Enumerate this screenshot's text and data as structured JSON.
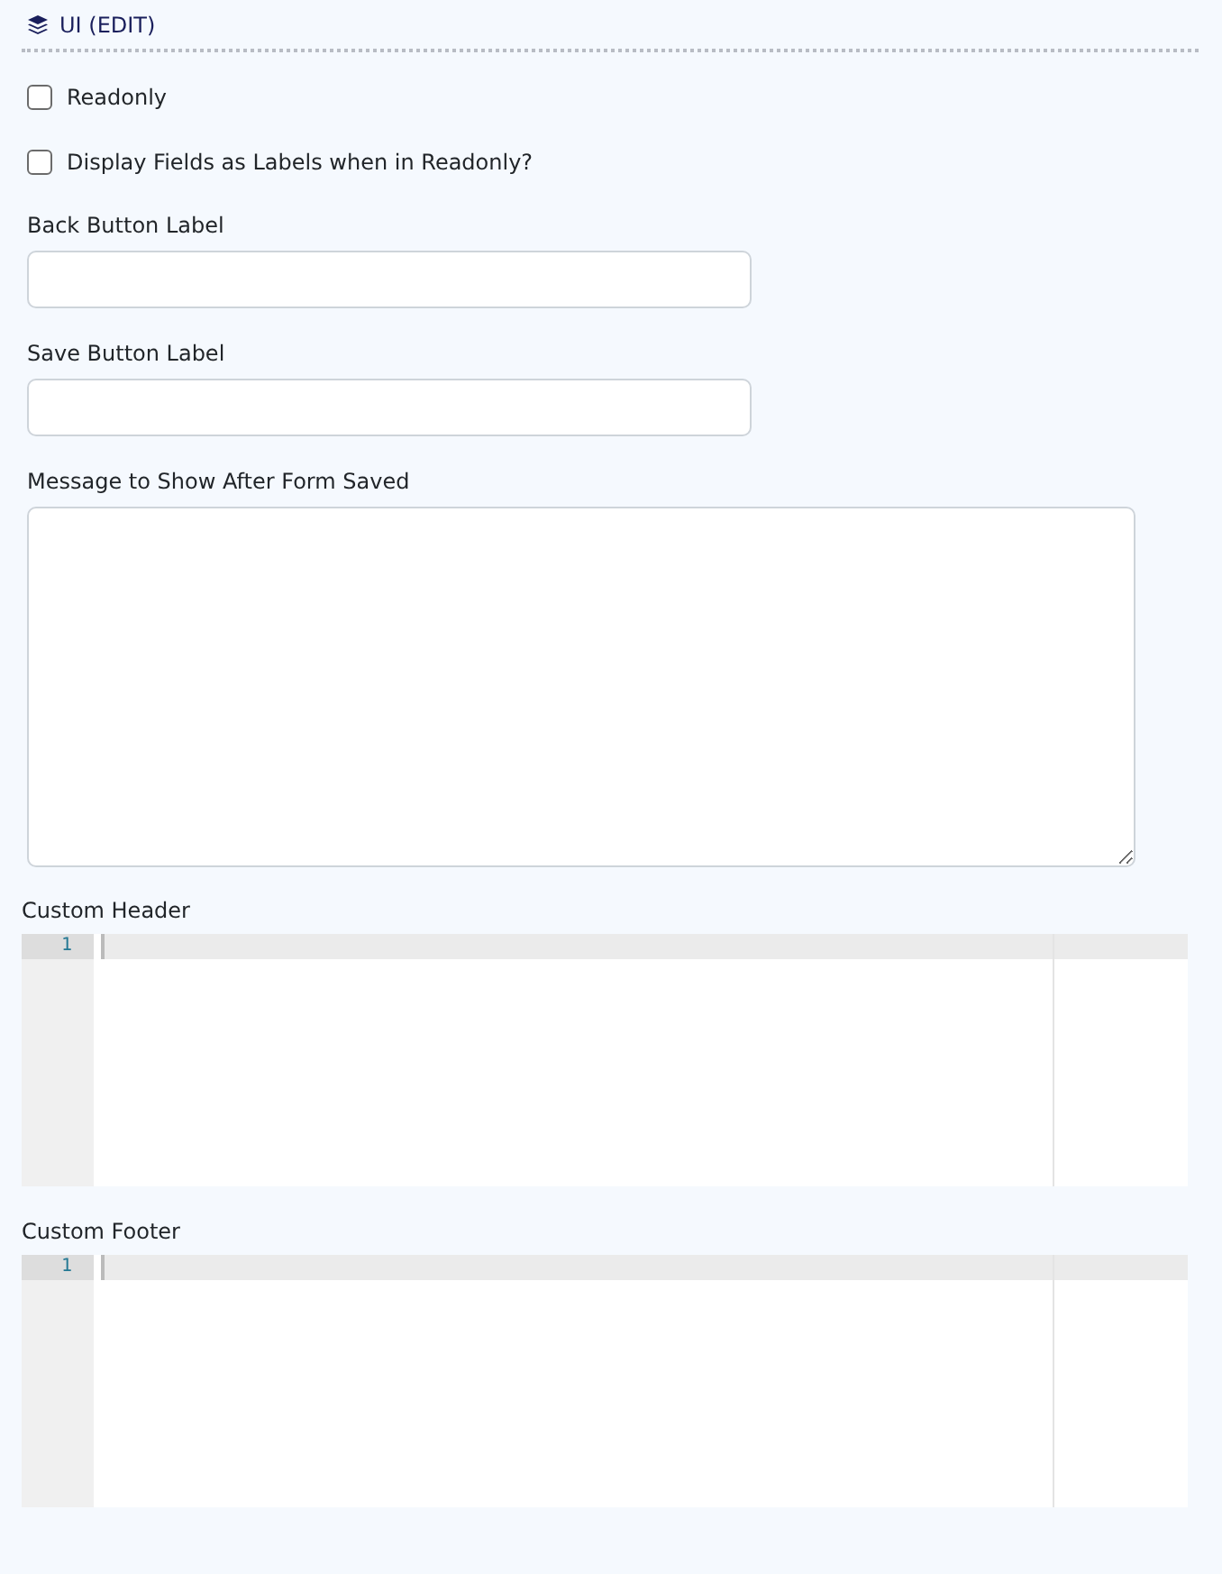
{
  "section": {
    "title": "UI (EDIT)"
  },
  "checkboxes": [
    {
      "label": "Readonly",
      "checked": false
    },
    {
      "label": "Display Fields as Labels when in Readonly?",
      "checked": false
    }
  ],
  "inputs": [
    {
      "label": "Back Button Label"
    },
    {
      "label": "Save Button Label"
    }
  ],
  "textarea": {
    "label": "Message to Show After Form Saved"
  },
  "editors": [
    {
      "label": "Custom Header",
      "line_numbers": [
        "1"
      ]
    },
    {
      "label": "Custom Footer",
      "line_numbers": [
        "1"
      ]
    }
  ]
}
